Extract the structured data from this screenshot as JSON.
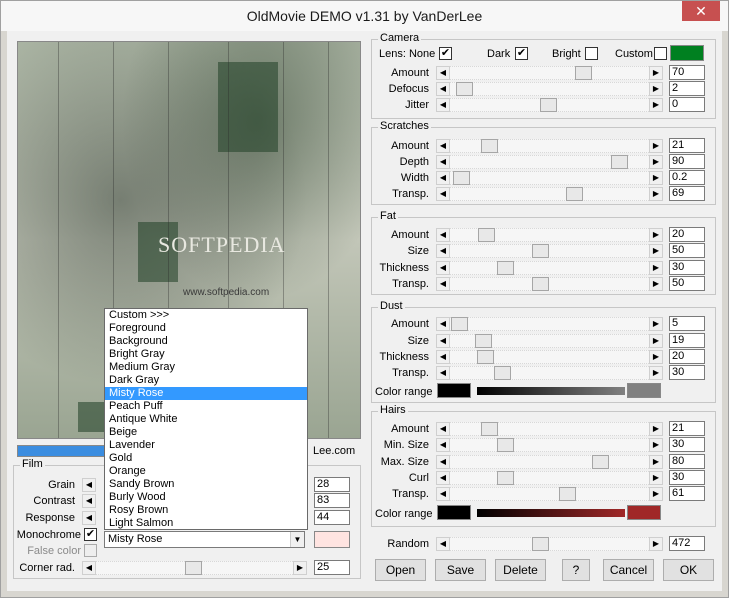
{
  "window": {
    "title": "OldMovie DEMO v1.31 by VanDerLee",
    "close_label": "✕"
  },
  "preview": {
    "watermark": "SOFTPEDIA",
    "watermark_url": "www.softpedia.com",
    "link_text": "Lee.com",
    "progress_pct": 100
  },
  "camera": {
    "title": "Camera",
    "lens_label": "Lens: None",
    "dark_label": "Dark",
    "dark_checked": true,
    "bright_label": "Bright",
    "bright_checked": false,
    "custom_label": "Custom",
    "custom_checked": false,
    "custom_color": "#008020",
    "sliders": [
      {
        "label": "Amount",
        "value": "70"
      },
      {
        "label": "Defocus",
        "value": "2"
      },
      {
        "label": "Jitter",
        "value": "0"
      }
    ]
  },
  "scratches": {
    "title": "Scratches",
    "sliders": [
      {
        "label": "Amount",
        "value": "21"
      },
      {
        "label": "Depth",
        "value": "90"
      },
      {
        "label": "Width",
        "value": "0.2"
      },
      {
        "label": "Transp.",
        "value": "69"
      }
    ]
  },
  "fat": {
    "title": "Fat",
    "sliders": [
      {
        "label": "Amount",
        "value": "20"
      },
      {
        "label": "Size",
        "value": "50"
      },
      {
        "label": "Thickness",
        "value": "30"
      },
      {
        "label": "Transp.",
        "value": "50"
      }
    ]
  },
  "dust": {
    "title": "Dust",
    "sliders": [
      {
        "label": "Amount",
        "value": "5"
      },
      {
        "label": "Size",
        "value": "19"
      },
      {
        "label": "Thickness",
        "value": "20"
      },
      {
        "label": "Transp.",
        "value": "30"
      }
    ],
    "color_range_label": "Color range",
    "color_from": "#000000",
    "color_to": "#808080"
  },
  "hairs": {
    "title": "Hairs",
    "sliders": [
      {
        "label": "Amount",
        "value": "21"
      },
      {
        "label": "Min. Size",
        "value": "30"
      },
      {
        "label": "Max. Size",
        "value": "80"
      },
      {
        "label": "Curl",
        "value": "30"
      },
      {
        "label": "Transp.",
        "value": "61"
      }
    ],
    "color_range_label": "Color range",
    "color_from": "#000000",
    "color_to": "#a02828"
  },
  "random": {
    "label": "Random",
    "value": "472"
  },
  "buttons": {
    "open": "Open",
    "save": "Save",
    "delete": "Delete",
    "help": "?",
    "cancel": "Cancel",
    "ok": "OK"
  },
  "film": {
    "title": "Film",
    "grain_label": "Grain",
    "grain_value": "28",
    "contrast_label": "Contrast",
    "contrast_value": "83",
    "response_label": "Response",
    "response_value": "44",
    "monochrome_label": "Monochrome",
    "monochrome_checked": true,
    "false_color_label": "False color",
    "false_color_checked": false,
    "corner_label": "Corner rad.",
    "corner_value": "25",
    "selected_color_name": "Misty Rose",
    "selected_swatch": "#ffe4e1"
  },
  "dropdown": {
    "selected": "Misty Rose",
    "options": [
      "Custom >>>",
      "Foreground",
      "Background",
      "Bright Gray",
      "Medium Gray",
      "Dark Gray",
      "Misty Rose",
      "Peach Puff",
      "Antique White",
      "Beige",
      "Lavender",
      "Gold",
      "Orange",
      "Sandy Brown",
      "Burly Wood",
      "Rosy Brown",
      "Light Salmon"
    ]
  }
}
